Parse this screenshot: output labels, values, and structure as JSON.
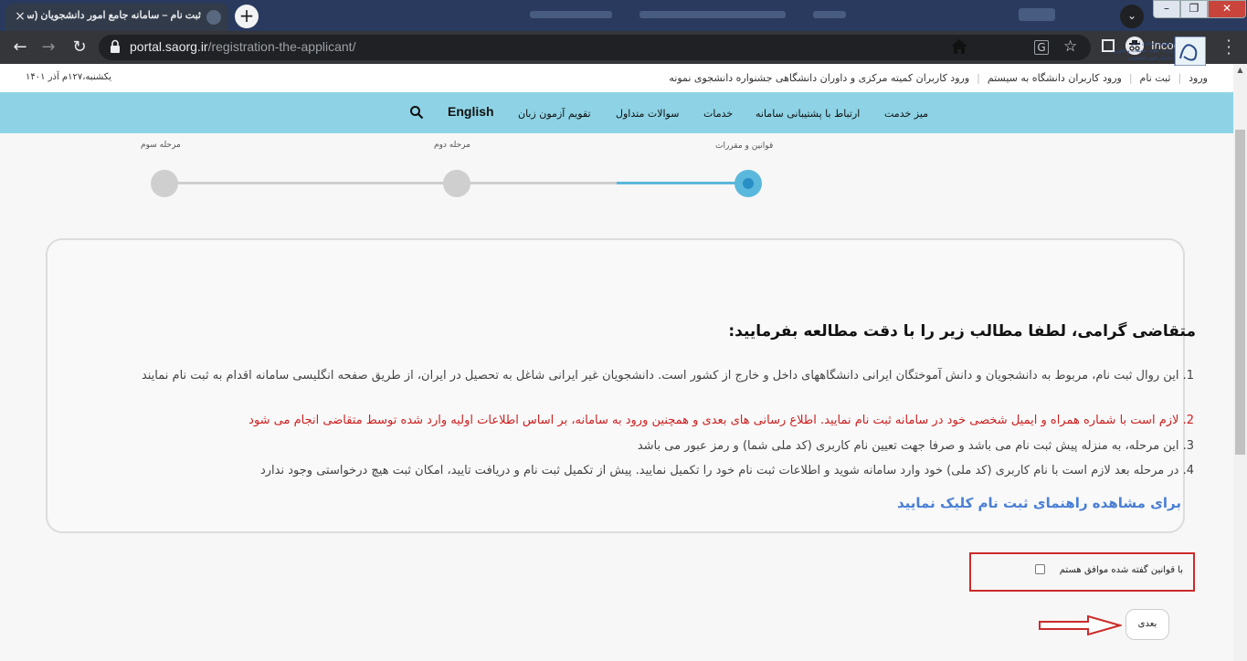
{
  "browser": {
    "tab_title": "ثبت نام – سامانه جامع امور دانشجویان (سج",
    "tab_close": "×",
    "new_tab": "+",
    "url_host": "portal.saorg.ir",
    "url_path": "/registration-the-applicant/",
    "incognito_label": "Incognito",
    "win_min": "–",
    "win_max": "❐",
    "win_close": "✕"
  },
  "topbar": {
    "date": "یکشنبه،۱۲۷م آذر ۱۴۰۱",
    "links": [
      "ورود",
      "ثبت نام",
      "ورود کاربران دانشگاه به سیستم",
      "ورود کاربران کمیته مرکزی و داوران دانشگاهی جشنواره دانشجوی نمونه"
    ]
  },
  "nav": {
    "logo_text_1": "جمهوری اسلامی ایران",
    "logo_text_2": "وزارت علوم، تحقیقات و فناوری",
    "logo_text_3": "سازمان امور دانشجویان",
    "items": [
      "میز خدمت",
      "ارتباط با پشتیبانی سامانه",
      "خدمات",
      "سوالات متداول",
      "تقویم آزمون زبان"
    ],
    "english": "English"
  },
  "stepper": {
    "steps": [
      {
        "label": "قوانین و مقررات",
        "active": true
      },
      {
        "label": "مرحله دوم",
        "active": false
      },
      {
        "label": "مرحله سوم",
        "active": false
      }
    ],
    "active_color": "#5ab8dc",
    "inactive_color": "#cfcfcf"
  },
  "content": {
    "heading": "متقاضی گرامی، لطفا مطالب زیر را با دقت مطالعه بفرمایید:",
    "items": [
      {
        "num": "1.",
        "text": "این روال ثبت نام، مربوط به دانشجویان و دانش آموختگان ایرانی دانشگاههای داخل و خارج از کشور است. دانشجویان غیر ایرانی شاغل به تحصیل در ایران، از طریق صفحه انگلیسی سامانه اقدام به ثبت نام نمایند",
        "color": "normal"
      },
      {
        "num": "2.",
        "text": "لازم است با شماره همراه و ایمیل شخصی خود در سامانه ثبت نام نمایید. اطلاع رسانی های بعدی و همچنین ورود به سامانه، بر اساس اطلاعات اولیه وارد شده توسط متقاضی انجام می شود",
        "color": "red"
      },
      {
        "num": "3.",
        "text": "این مرحله، به منزله پیش ثبت نام می باشد و صرفا جهت تعیین نام کاربری (کد ملی شما) و رمز عبور می باشد",
        "color": "normal"
      },
      {
        "num": "4.",
        "text": "در مرحله بعد لازم است با نام کاربری (کد ملی) خود وارد سامانه شوید و اطلاعات ثبت نام خود را تکمیل نمایید. پیش از تکمیل ثبت نام و دریافت تایید، امکان ثبت هیچ درخواستی وجود ندارد",
        "color": "normal"
      }
    ],
    "guide_link": "برای مشاهده راهنمای ثبت نام کلیک نمایید"
  },
  "form": {
    "agree_label": "با قوانین گفته شده موافق هستم",
    "next_label": "بعدی"
  },
  "colors": {
    "navbar": "#8dd3e5",
    "highlight_red": "#cc2b2b",
    "link_blue": "#4a7fd4"
  }
}
